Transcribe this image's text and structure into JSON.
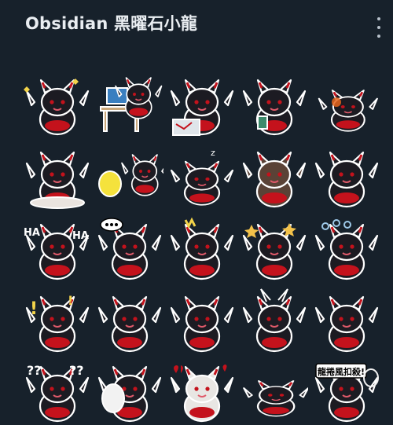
{
  "header": {
    "title": "Obsidian 黑曜石小龍",
    "menu_icon": "more-vertical-icon"
  },
  "colors": {
    "background": "#17212b",
    "dragon_body": "#1c1b22",
    "accent_red": "#c4121c",
    "outline": "#ffffff"
  },
  "stickers": [
    {
      "icon": "dragon-sticker",
      "variant": "sparkle-wings"
    },
    {
      "icon": "dragon-sticker",
      "variant": "at-computer-desk"
    },
    {
      "icon": "dragon-sticker",
      "variant": "laptop-shout"
    },
    {
      "icon": "dragon-sticker",
      "variant": "angry-phone"
    },
    {
      "icon": "dragon-sticker",
      "variant": "lying-glow"
    },
    {
      "icon": "dragon-sticker",
      "variant": "sitting-plate"
    },
    {
      "icon": "dragon-sticker",
      "variant": "lemon"
    },
    {
      "icon": "dragon-sticker",
      "variant": "sleeping"
    },
    {
      "icon": "dragon-sticker",
      "variant": "tan-dragon"
    },
    {
      "icon": "dragon-sticker",
      "variant": "sitting-happy"
    },
    {
      "icon": "dragon-sticker",
      "variant": "laughing-ha"
    },
    {
      "icon": "dragon-sticker",
      "variant": "speech-dots"
    },
    {
      "icon": "dragon-sticker",
      "variant": "shout"
    },
    {
      "icon": "dragon-sticker",
      "variant": "star-sparkle"
    },
    {
      "icon": "dragon-sticker",
      "variant": "dizzy"
    },
    {
      "icon": "dragon-sticker",
      "variant": "exclaim"
    },
    {
      "icon": "dragon-sticker",
      "variant": "crying"
    },
    {
      "icon": "dragon-sticker",
      "variant": "thinking"
    },
    {
      "icon": "dragon-sticker",
      "variant": "horned"
    },
    {
      "icon": "dragon-sticker",
      "variant": "bored"
    },
    {
      "icon": "dragon-sticker",
      "variant": "question-marks"
    },
    {
      "icon": "dragon-sticker",
      "variant": "hug"
    },
    {
      "icon": "dragon-sticker",
      "variant": "hearts-white"
    },
    {
      "icon": "dragon-sticker",
      "variant": "lying-flat"
    },
    {
      "icon": "dragon-sticker",
      "variant": "sign-badminton"
    }
  ],
  "sticker_sign_text": "龍捲風扣殺!"
}
